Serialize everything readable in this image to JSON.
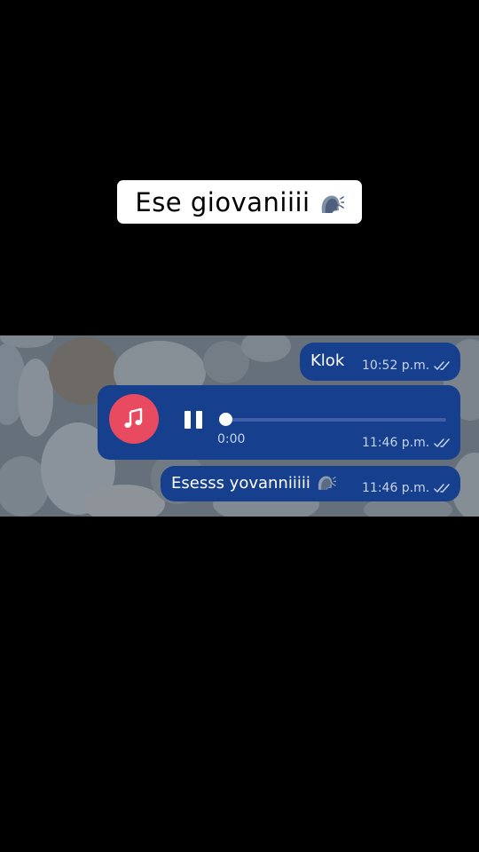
{
  "caption": {
    "text": "Ese giovaniiii",
    "icon": "speaking-head-icon"
  },
  "messages": [
    {
      "text": "Klok",
      "time": "10:52 p.m."
    },
    {
      "type": "audio",
      "elapsed": "0:00",
      "time": "11:46 p.m.",
      "icon": "music-note-icon",
      "progress": 0
    },
    {
      "text": "Esesss yovanniiiii",
      "time": "11:46 p.m.",
      "icon": "speaking-head-icon"
    }
  ],
  "colors": {
    "bubble": "#163f8e",
    "audio_disc": "#e84a5f",
    "meta_text": "#c7d3ea",
    "background": "#000000"
  }
}
